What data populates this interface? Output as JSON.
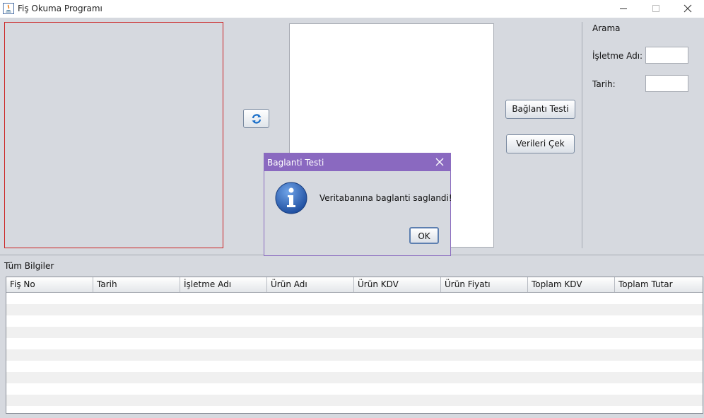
{
  "window": {
    "title": "Fiş Okuma Programı"
  },
  "main": {
    "buttons": {
      "connection_test": "Bağlantı Testi",
      "fetch_data": "Verileri Çek"
    }
  },
  "search": {
    "heading": "Arama",
    "business_label": "İşletme Adı:",
    "business_value": "",
    "date_label": "Tarih:",
    "date_value": ""
  },
  "table": {
    "section_label": "Tüm Bilgiler",
    "columns": [
      "Fiş No",
      "Tarih",
      "İşletme Adı",
      "Ürün Adı",
      "Ürün KDV",
      "Ürün Fiyatı",
      "Toplam KDV",
      "Toplam Tutar"
    ],
    "rows": []
  },
  "dialog": {
    "title": "Baglanti Testi",
    "message": "Veritabanına baglanti saglandi!",
    "ok_label": "OK"
  },
  "colors": {
    "dialog_title_bar": "#8a69c0",
    "image_panel_border": "#cc2222",
    "background": "#d6d9df"
  },
  "icons": [
    "java-app-icon",
    "minimize-icon",
    "maximize-icon",
    "close-icon",
    "refresh-icon",
    "info-icon",
    "dialog-close-icon"
  ]
}
